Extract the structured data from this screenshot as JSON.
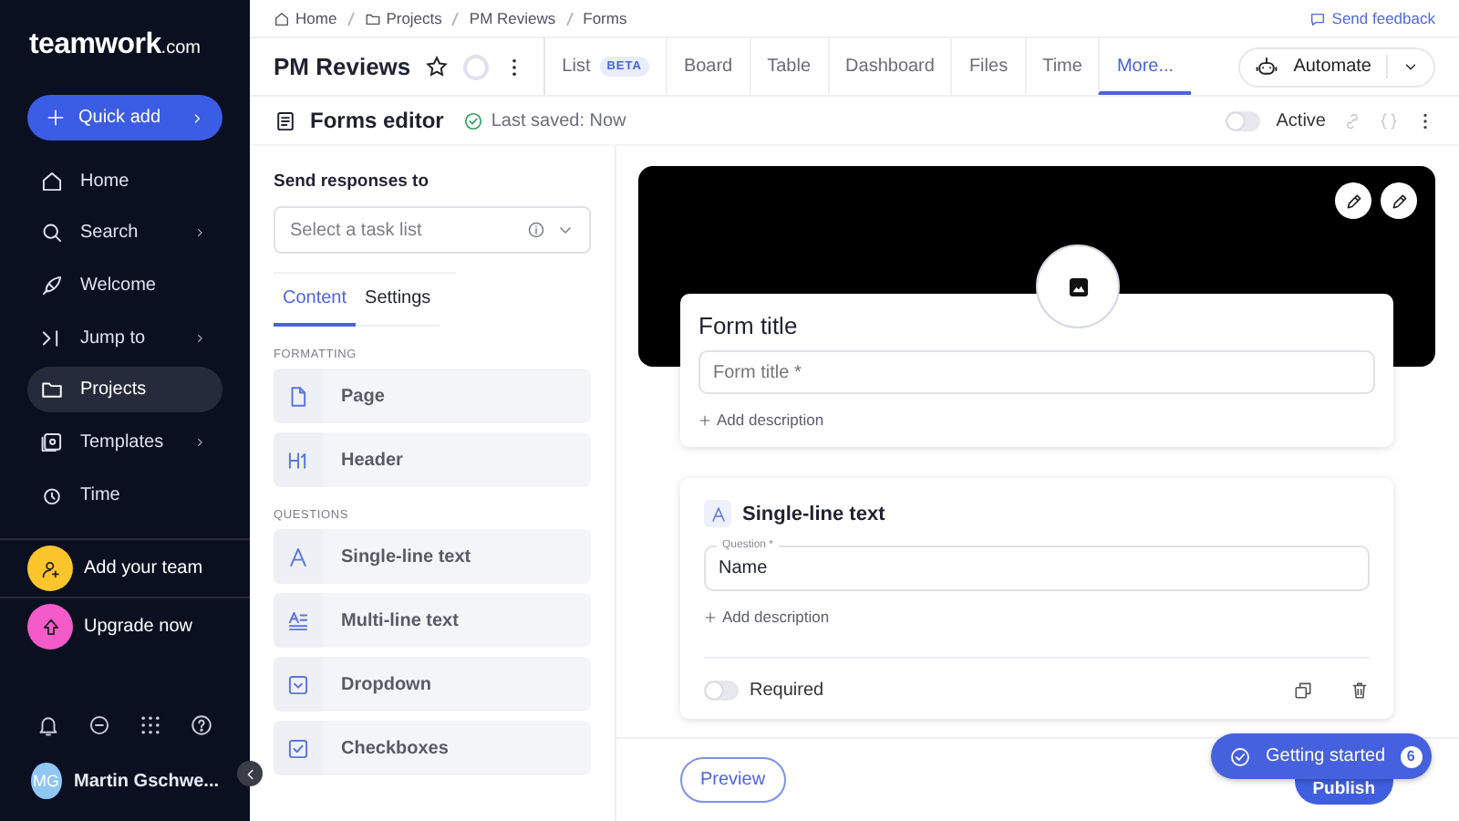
{
  "sidebar": {
    "logo": "teamwork",
    "logo_suffix": ".com",
    "quick_add": "Quick add",
    "items": [
      {
        "label": "Home",
        "chevron": false,
        "selected": false
      },
      {
        "label": "Search",
        "chevron": true,
        "selected": false
      },
      {
        "label": "Welcome",
        "chevron": false,
        "selected": false
      },
      {
        "label": "Jump to",
        "chevron": true,
        "selected": false
      },
      {
        "label": "Projects",
        "chevron": false,
        "selected": true
      },
      {
        "label": "Templates",
        "chevron": true,
        "selected": false
      },
      {
        "label": "Time",
        "chevron": false,
        "selected": false
      }
    ],
    "promos": [
      {
        "label": "Add your team",
        "color": "#fcc52c"
      },
      {
        "label": "Upgrade now",
        "color": "#f45ac8"
      }
    ],
    "user": {
      "initials": "MG",
      "name": "Martin Gschwe..."
    }
  },
  "breadcrumbs": [
    "Home",
    "Projects",
    "PM Reviews",
    "Forms"
  ],
  "feedback": "Send feedback",
  "project": {
    "title": "PM Reviews",
    "starred": false
  },
  "tabs": [
    {
      "label": "List",
      "badge": "BETA",
      "selected": false
    },
    {
      "label": "Board",
      "selected": false
    },
    {
      "label": "Table",
      "selected": false
    },
    {
      "label": "Dashboard",
      "selected": false
    },
    {
      "label": "Files",
      "selected": false
    },
    {
      "label": "Time",
      "selected": false
    },
    {
      "label": "More...",
      "selected": true
    }
  ],
  "automate": "Automate",
  "editor": {
    "title": "Forms editor",
    "saved": "Last saved: Now",
    "active": {
      "label": "Active",
      "on": false
    }
  },
  "panel": {
    "send_to": "Send responses to",
    "select_placeholder": "Select a task list",
    "tabs": [
      {
        "label": "Content",
        "selected": true
      },
      {
        "label": "Settings",
        "selected": false
      }
    ],
    "sections": [
      {
        "title": "FORMATTING",
        "items": [
          {
            "label": "Page",
            "kind": "page"
          },
          {
            "label": "Header",
            "kind": "header"
          }
        ]
      },
      {
        "title": "QUESTIONS",
        "items": [
          {
            "label": "Single-line text",
            "kind": "single"
          },
          {
            "label": "Multi-line text",
            "kind": "multi"
          },
          {
            "label": "Dropdown",
            "kind": "dropdown"
          },
          {
            "label": "Checkboxes",
            "kind": "checkboxes"
          }
        ]
      }
    ]
  },
  "form": {
    "heading": "Form title",
    "title_placeholder": "Form title *",
    "add_description": "Add description",
    "question": {
      "type_label": "Single-line text",
      "field_label": "Question *",
      "value": "Name",
      "add_description": "Add description",
      "required": {
        "label": "Required",
        "on": false
      }
    }
  },
  "footer": {
    "preview": "Preview",
    "publish": "Publish",
    "getting_started": {
      "label": "Getting started",
      "count": "6"
    }
  }
}
